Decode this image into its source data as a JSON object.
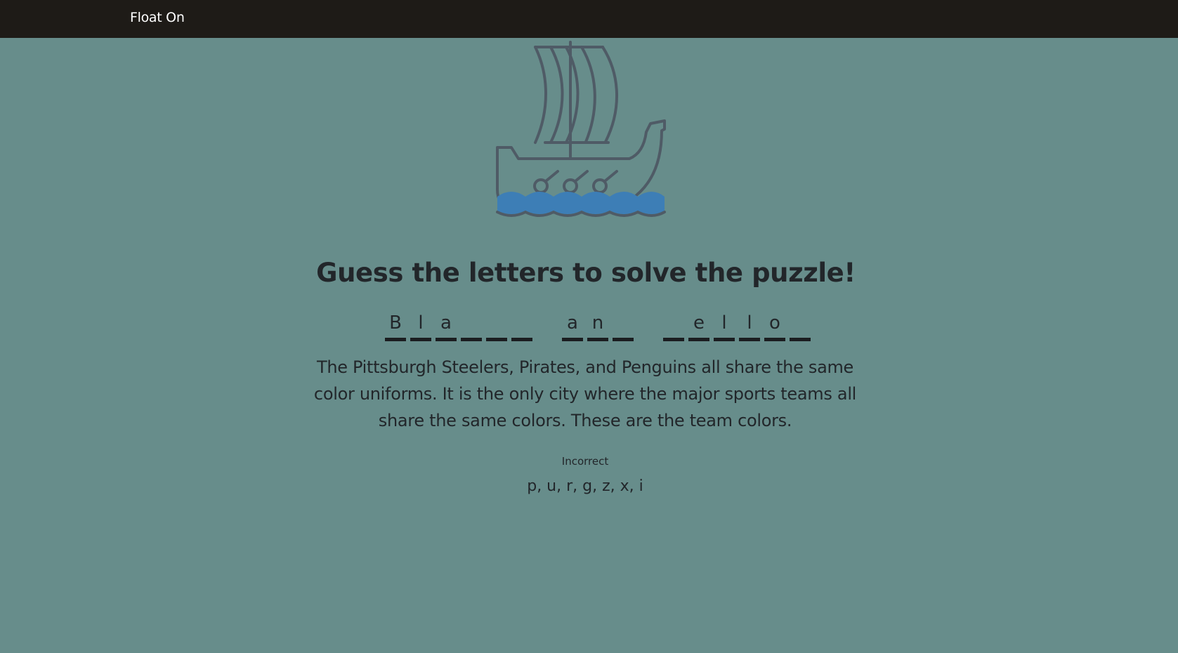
{
  "nav": {
    "brand": "Float On"
  },
  "illustration": {
    "icon": "viking-ship-icon",
    "stroke_color": "#4f5b66",
    "water_color": "#3d7eb6"
  },
  "game": {
    "heading": "Guess the letters to solve the puzzle!",
    "slots": [
      "B",
      "l",
      "a",
      "",
      "",
      "",
      " ",
      "a",
      "n",
      "",
      " ",
      "",
      "e",
      "l",
      "l",
      "o",
      ""
    ],
    "hint": "The Pittsburgh Steelers, Pirates, and Penguins all share the same color uniforms. It is the only city where the major sports teams all share the same colors. These are the team colors.",
    "incorrect_label": "Incorrect",
    "incorrect_letters": "p, u, r, g, z, x, i"
  }
}
